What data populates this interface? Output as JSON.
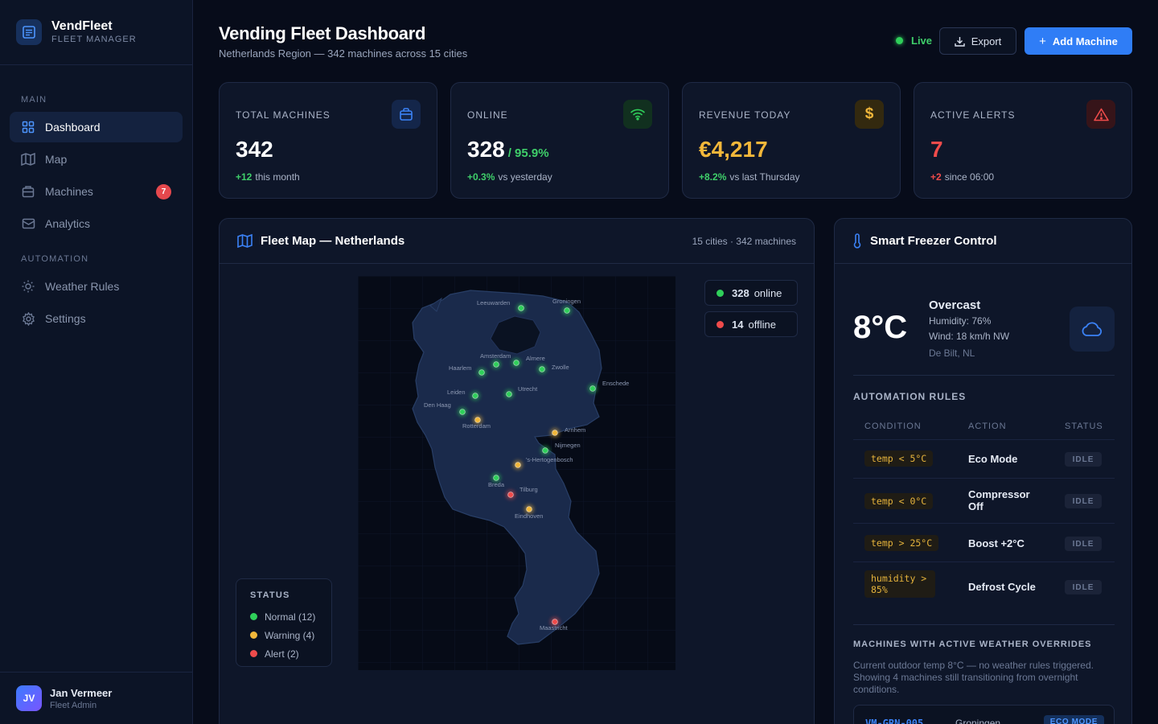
{
  "brand": {
    "name": "VendFleet",
    "subtitle": "FLEET MANAGER"
  },
  "nav": {
    "main_label": "MAIN",
    "automation_label": "AUTOMATION",
    "items": [
      {
        "label": "Dashboard",
        "icon": "grid-icon",
        "active": true
      },
      {
        "label": "Map",
        "icon": "map-icon"
      },
      {
        "label": "Machines",
        "icon": "machine-icon",
        "badge": "7"
      },
      {
        "label": "Analytics",
        "icon": "analytics-icon"
      },
      {
        "label": "Weather Rules",
        "icon": "sun-icon"
      },
      {
        "label": "Settings",
        "icon": "gear-icon"
      }
    ]
  },
  "user": {
    "initials": "JV",
    "name": "Jan Vermeer",
    "role": "Fleet Admin"
  },
  "header": {
    "title": "Vending Fleet Dashboard",
    "subtitle": "Netherlands Region — 342 machines across 15 cities",
    "live_label": "Live",
    "export_label": "Export",
    "add_label": "Add Machine"
  },
  "stats": [
    {
      "label": "TOTAL MACHINES",
      "value": "342",
      "extra": "",
      "delta": "+12",
      "foot": "this month",
      "value_color": "#ffffff",
      "delta_color": "#3fcf6a",
      "icon": "bag-icon",
      "icon_color": "#3b82f6",
      "icon_bg": "#14264a"
    },
    {
      "label": "ONLINE",
      "value": "328",
      "extra": "/ 95.9%",
      "delta": "+0.3%",
      "foot": "vs yesterday",
      "value_color": "#ffffff",
      "delta_color": "#3fcf6a",
      "icon": "wifi-icon",
      "icon_color": "#2fcf5a",
      "icon_bg": "#11301f"
    },
    {
      "label": "REVENUE TODAY",
      "value": "€4,217",
      "extra": "",
      "delta": "+8.2%",
      "foot": "vs last Thursday",
      "value_color": "#f2b73a",
      "delta_color": "#3fcf6a",
      "icon": "dollar-icon",
      "icon_color": "#f2b73a",
      "icon_bg": "#33290f"
    },
    {
      "label": "ACTIVE ALERTS",
      "value": "7",
      "extra": "",
      "delta": "+2",
      "foot": "since 06:00",
      "value_color": "#ef4b4b",
      "delta_color": "#ef4b4b",
      "icon": "alert-icon",
      "icon_color": "#ef4b4b",
      "icon_bg": "#361419"
    }
  ],
  "map_panel": {
    "title": "Fleet Map — Netherlands",
    "meta": "15 cities · 342 machines",
    "online": {
      "count": "328",
      "label": "online"
    },
    "offline": {
      "count": "14",
      "label": "offline"
    },
    "legend": {
      "title": "STATUS",
      "items": [
        {
          "label": "Normal (12)",
          "color": "#2fcf5a"
        },
        {
          "label": "Warning (4)",
          "color": "#f2b73a"
        },
        {
          "label": "Alert (2)",
          "color": "#ef4b4b"
        }
      ]
    },
    "cities": [
      {
        "name": "Leeuwarden",
        "status": "normal"
      },
      {
        "name": "Groningen",
        "status": "normal"
      },
      {
        "name": "Amsterdam",
        "status": "normal"
      },
      {
        "name": "Almere",
        "status": "normal"
      },
      {
        "name": "Haarlem",
        "status": "normal"
      },
      {
        "name": "Zwolle",
        "status": "normal"
      },
      {
        "name": "Enschede",
        "status": "normal"
      },
      {
        "name": "Leiden",
        "status": "normal"
      },
      {
        "name": "Utrecht",
        "status": "normal"
      },
      {
        "name": "Den Haag",
        "status": "normal"
      },
      {
        "name": "Rotterdam",
        "status": "warning"
      },
      {
        "name": "Arnhem",
        "status": "warning"
      },
      {
        "name": "Nijmegen",
        "status": "normal"
      },
      {
        "name": "'s-Hertogenbosch",
        "status": "warning"
      },
      {
        "name": "Breda",
        "status": "normal"
      },
      {
        "name": "Tilburg",
        "status": "alert"
      },
      {
        "name": "Eindhoven",
        "status": "warning"
      },
      {
        "name": "Maastricht",
        "status": "alert"
      }
    ]
  },
  "freezer": {
    "title": "Smart Freezer Control",
    "temperature": "8°C",
    "condition": "Overcast",
    "humidity": "Humidity: 76%",
    "wind": "Wind: 18 km/h NW",
    "location": "De Bilt, NL",
    "rules_title": "AUTOMATION RULES",
    "columns": [
      "CONDITION",
      "ACTION",
      "STATUS"
    ],
    "rules": [
      {
        "condition": "temp < 5°C",
        "action": "Eco Mode",
        "status": "IDLE"
      },
      {
        "condition": "temp < 0°C",
        "action": "Compressor Off",
        "status": "IDLE"
      },
      {
        "condition": "temp > 25°C",
        "action": "Boost +2°C",
        "status": "IDLE"
      },
      {
        "condition": "humidity > 85%",
        "action": "Defrost Cycle",
        "status": "IDLE"
      }
    ],
    "overrides_title": "MACHINES WITH ACTIVE WEATHER OVERRIDES",
    "overrides_note": "Current outdoor temp 8°C — no weather rules triggered. Showing 4 machines still transitioning from overnight conditions.",
    "overrides": [
      {
        "id": "VM-GRN-005",
        "city": "Groningen",
        "mode": "ECO MODE"
      }
    ]
  }
}
